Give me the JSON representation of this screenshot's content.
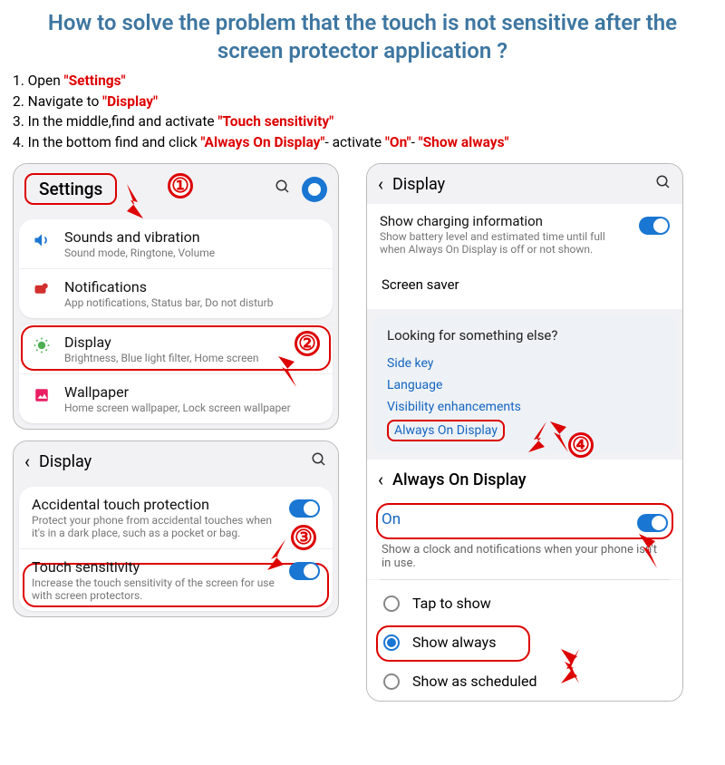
{
  "title": "How to solve the problem that the touch is not sensitive after  the screen protector application ?",
  "steps": {
    "s1a": "1. Open ",
    "s1b": "\"Settings\"",
    "s2a": "2. Navigate to ",
    "s2b": "\"Display\"",
    "s3a": "3. In the middle,find and activate ",
    "s3b": "\"Touch sensitivity\"",
    "s4a": "4. In the bottom find and click ",
    "s4b": "\"Always On Display\"",
    "s4c": "- activate ",
    "s4d": "\"On\"",
    "s4e": "- ",
    "s4f": "\"Show always\""
  },
  "nums": {
    "n1": "①",
    "n2": "②",
    "n3": "③",
    "n4": "④"
  },
  "left": {
    "settings": "Settings",
    "sounds": {
      "t": "Sounds and vibration",
      "s": "Sound mode, Ringtone, Volume"
    },
    "notif": {
      "t": "Notifications",
      "s": "App notifications, Status bar, Do not disturb"
    },
    "display": {
      "t": "Display",
      "s": "Brightness, Blue light filter, Home screen"
    },
    "wallpaper": {
      "t": "Wallpaper",
      "s": "Home screen wallpaper, Lock screen wallpaper"
    },
    "displayHdr": "Display",
    "atp": {
      "t": "Accidental touch protection",
      "s": "Protect your phone from accidental touches when it's in a dark place, such as a pocket or bag."
    },
    "ts": {
      "t": "Touch sensitivity",
      "s": "Increase the touch sensitivity of the screen for use with screen protectors."
    }
  },
  "right": {
    "displayHdr": "Display",
    "charging": {
      "t": "Show charging information",
      "s": "Show battery level and estimated time until full when Always On Display is off or not shown."
    },
    "ss": "Screen saver",
    "looking": "Looking for something else?",
    "links": {
      "side": "Side key",
      "lang": "Language",
      "vis": "Visibility enhancements",
      "aod": "Always On Display"
    },
    "aodHdr": "Always On Display",
    "on": "On",
    "onDesc": "Show a clock and notifications when your phone isn't in use.",
    "tap": "Tap to show",
    "showAlways": "Show always",
    "sched": "Show as scheduled"
  }
}
